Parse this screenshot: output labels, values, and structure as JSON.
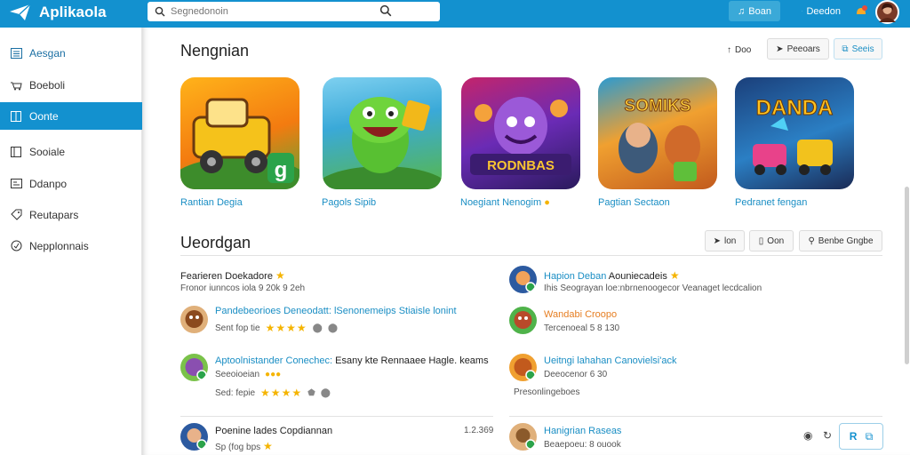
{
  "app": {
    "name": "Aplikaola"
  },
  "search": {
    "placeholder": "Segnedonoin"
  },
  "topbar": {
    "button1": "Boan",
    "button2": "Deedon"
  },
  "sidebar": {
    "items": [
      {
        "label": "Aesgan",
        "icon": "grid-icon"
      },
      {
        "label": "Boeboli",
        "icon": "cart-icon"
      },
      {
        "label": "Oonte",
        "icon": "book-icon",
        "active": true
      },
      {
        "label": "Sooiale",
        "icon": "book-open-icon"
      },
      {
        "label": "Ddanpo",
        "icon": "card-icon"
      },
      {
        "label": "Reutapars",
        "icon": "tag-icon"
      },
      {
        "label": "Nepplonnais",
        "icon": "clock-icon"
      }
    ]
  },
  "featured": {
    "title": "Nengnian",
    "sort_label": "Doo",
    "btn1": "Peeoars",
    "btn2": "Seeis",
    "apps": [
      {
        "label": "Rantian Degia",
        "art_text": "g"
      },
      {
        "label": "Pagols Sipib",
        "art_text": ""
      },
      {
        "label": "Noegiant Nenogim",
        "art_text": "RODNBAS"
      },
      {
        "label": "Pagtian Sectaon",
        "art_text": "SOMIKS"
      },
      {
        "label": "Pedranet fengan",
        "art_text": "DANDA"
      }
    ]
  },
  "recent": {
    "title": "Ueordgan",
    "btn1": "lon",
    "btn2": "Oon",
    "btn3": "Benbe Gngbe",
    "left_col": {
      "header_title": "Fearieren Doekadore",
      "header_sub": "Fronor iunncos iola 9 20k 9 2eh",
      "items": [
        {
          "title_link": "Pandebeorioes",
          "title_rest": "Deneodatt: lSenonemeips Stiaisle lonint",
          "sub": "Sent fop tie"
        },
        {
          "title_link": "Aptoolnistander Conechec:",
          "title_rest": "Esany kte Rennaaee Hagle. keams",
          "sub": "Seeoioeian",
          "sub2": "Sed: fepie"
        }
      ],
      "bottom_title": "Poenine lades Copdiannan",
      "bottom_value": "1.2.369",
      "bottom_sub": "Sp (fog bps"
    },
    "right_col": {
      "header_title_link": "Hapion Deban",
      "header_title_rest": "Aouniecadeis",
      "header_sub": "Ihis Seograyan loe:nbrnenoogecor Veanaget lecdcalion",
      "items": [
        {
          "title": "Wandabi Croopo",
          "sub": "Tercenoeal 5 8 130"
        },
        {
          "title": "Ueitngi lahahan Canovielsi'ack",
          "sub": "Deeocenor 6 30",
          "sub2": "Presonlingeboes"
        }
      ],
      "bottom_title": "Hanigrian Raseas",
      "bottom_sub": "Beaepoeu: 8 ouook"
    }
  },
  "colors": {
    "primary": "#1391cf",
    "link": "#1a8ec4",
    "star": "#f5b400",
    "orange": "#e67e22"
  }
}
